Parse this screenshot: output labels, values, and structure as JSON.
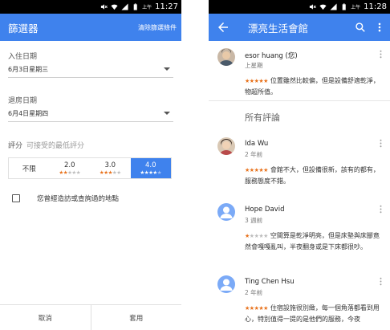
{
  "left": {
    "status": {
      "time": "11:27",
      "ampm": "上午"
    },
    "appbar": {
      "title": "篩選器",
      "clear_label": "清除篩選條件"
    },
    "checkin": {
      "label": "入住日期",
      "value": "6月3日星期三"
    },
    "checkout": {
      "label": "退房日期",
      "value": "6月4日星期四"
    },
    "rating": {
      "label": "評分",
      "hint": "可接受的最低評分",
      "options": [
        {
          "label": "不限",
          "stars": 0
        },
        {
          "label": "2.0",
          "stars": 2
        },
        {
          "label": "3.0",
          "stars": 3
        },
        {
          "label": "4.0",
          "stars": 4
        }
      ],
      "selected_index": 3
    },
    "visited": {
      "label": "您曾經造訪或查詢過的地點",
      "checked": false
    },
    "buttons": {
      "cancel": "取消",
      "apply": "套用"
    }
  },
  "right": {
    "status": {
      "time": "11:28",
      "ampm": "上午"
    },
    "appbar": {
      "title": "漂亮生活會館"
    },
    "section_title": "所有評論",
    "reviews": [
      {
        "name": "esor huang (您)",
        "time": "上星期",
        "stars": 5,
        "text": "位置雖然比較偏，但是設備舒適乾淨，物超所值。"
      },
      {
        "name": "Ida Wu",
        "time": "2 年前",
        "stars": 5,
        "text": "會館不大，但設備很新，該有的都有，服務態度不錯。"
      },
      {
        "name": "Hope David",
        "time": "3 週前",
        "stars": 1,
        "text": "空間算是乾淨明亮，但是床墊與床腳竟然會嘎嘎亂叫，半夜翻身或是下床都很吵。"
      },
      {
        "name": "Ting Chen Hsu",
        "time": "2 年前",
        "stars": 5,
        "text": "住宿設施很別緻，每一個角落都看到用心，特別值得一提的是他們的服務，今夜"
      }
    ]
  },
  "colors": {
    "accent": "#3f82ed",
    "star": "#e8711a",
    "statusbar": "#000000"
  },
  "icons": {
    "back": "arrow-left-icon",
    "search": "search-icon",
    "more": "more-vert-icon",
    "wifi": "wifi-icon",
    "mute": "volume-mute-icon",
    "battery": "battery-icon",
    "signal": "signal-icon"
  }
}
